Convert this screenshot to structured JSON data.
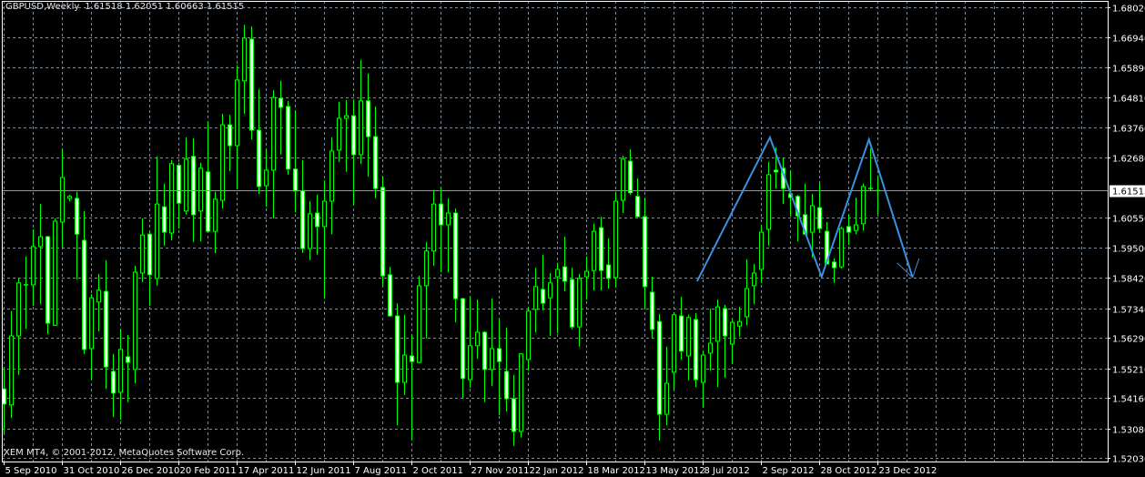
{
  "header": {
    "symbol_period": "GBPUSD,Weekly",
    "ohlc": "1.61518 1.62051 1.60663 1.61515"
  },
  "footer": {
    "copyright": "XEM MT4, © 2001-2012, MetaQuotes Software Corp."
  },
  "colors": {
    "background": "#000000",
    "grid": "#7f8b99",
    "candle_outline": "#00ff00",
    "bull_fill": "#000000",
    "bear_fill": "#ffffff",
    "axis_text": "#ffffff",
    "drawing": "#3d8fe0",
    "price_line": "#8a96a6"
  },
  "chart_data": {
    "type": "candlestick",
    "title": "GBPUSD,Weekly",
    "symbol": "GBPUSD",
    "period": "Weekly",
    "ylim": [
      1.5203,
      1.6802
    ],
    "grid": true,
    "y_tick_labels": [
      "1.68020",
      "1.66940",
      "1.65890",
      "1.64810",
      "1.63760",
      "1.62680",
      "1.60550",
      "1.59500",
      "1.58420",
      "1.57340",
      "1.56290",
      "1.55210",
      "1.54160",
      "1.53080",
      "1.52030"
    ],
    "current_price": "1.61515",
    "x_tick_labels": [
      "5 Sep 2010",
      "31 Oct 2010",
      "26 Dec 2010",
      "20 Feb 2011",
      "17 Apr 2011",
      "12 Jun 2011",
      "7 Aug 2011",
      "2 Oct 2011",
      "27 Nov 2011",
      "22 Jan 2012",
      "18 Mar 2012",
      "13 May 2012",
      "8 Jul 2012",
      "2 Sep 2012",
      "28 Oct 2012",
      "23 Dec 2012"
    ],
    "x_tick_every_bars": 8,
    "ohlc": [
      [
        1.5448,
        1.5526,
        1.5294,
        1.5394
      ],
      [
        1.5391,
        1.5724,
        1.5345,
        1.5636
      ],
      [
        1.5636,
        1.584,
        1.5498,
        1.5824
      ],
      [
        1.5817,
        1.5918,
        1.5662,
        1.5817
      ],
      [
        1.5817,
        1.6014,
        1.5743,
        1.5953
      ],
      [
        1.5953,
        1.6104,
        1.5749,
        1.5988
      ],
      [
        1.5988,
        1.5991,
        1.5642,
        1.5681
      ],
      [
        1.5674,
        1.6053,
        1.5671,
        1.6043
      ],
      [
        1.604,
        1.6298,
        1.5953,
        1.6198
      ],
      [
        1.6124,
        1.6137,
        1.6114,
        1.6131
      ],
      [
        1.6124,
        1.6147,
        1.5836,
        1.5997
      ],
      [
        1.5975,
        1.6079,
        1.5572,
        1.5588
      ],
      [
        1.5591,
        1.5784,
        1.5478,
        1.5771
      ],
      [
        1.5756,
        1.5856,
        1.5652,
        1.5798
      ],
      [
        1.5794,
        1.5905,
        1.5448,
        1.5526
      ],
      [
        1.551,
        1.5572,
        1.5348,
        1.5433
      ],
      [
        1.5436,
        1.5659,
        1.5339,
        1.5588
      ],
      [
        1.5562,
        1.5639,
        1.5401,
        1.5542
      ],
      [
        1.5517,
        1.5885,
        1.5468,
        1.5862
      ],
      [
        1.5859,
        1.6053,
        1.5827,
        1.5994
      ],
      [
        1.5997,
        1.601,
        1.5743,
        1.5853
      ],
      [
        1.584,
        1.6273,
        1.5814,
        1.6104
      ],
      [
        1.6094,
        1.6176,
        1.5956,
        1.6004
      ],
      [
        1.6001,
        1.626,
        1.5975,
        1.6247
      ],
      [
        1.6241,
        1.625,
        1.6017,
        1.6107
      ],
      [
        1.6079,
        1.634,
        1.6066,
        1.6263
      ],
      [
        1.6273,
        1.6337,
        1.5969,
        1.6066
      ],
      [
        1.6079,
        1.625,
        1.5972,
        1.6231
      ],
      [
        1.6218,
        1.6395,
        1.6007,
        1.6007
      ],
      [
        1.6007,
        1.6147,
        1.593,
        1.6121
      ],
      [
        1.6117,
        1.6424,
        1.6088,
        1.6385
      ],
      [
        1.6385,
        1.6421,
        1.6221,
        1.6311
      ],
      [
        1.6311,
        1.6596,
        1.6156,
        1.6544
      ],
      [
        1.6541,
        1.674,
        1.6424,
        1.6693
      ],
      [
        1.6689,
        1.6734,
        1.6333,
        1.6366
      ],
      [
        1.6366,
        1.6511,
        1.614,
        1.6166
      ],
      [
        1.6169,
        1.6301,
        1.6094,
        1.6224
      ],
      [
        1.6224,
        1.6508,
        1.6053,
        1.6482
      ],
      [
        1.6479,
        1.6541,
        1.6279,
        1.6447
      ],
      [
        1.645,
        1.647,
        1.6208,
        1.6228
      ],
      [
        1.6228,
        1.6437,
        1.6075,
        1.615
      ],
      [
        1.615,
        1.626,
        1.593,
        1.5946
      ],
      [
        1.5946,
        1.6114,
        1.5905,
        1.6069
      ],
      [
        1.6072,
        1.6137,
        1.5924,
        1.6024
      ],
      [
        1.6024,
        1.6188,
        1.5768,
        1.6114
      ],
      [
        1.6114,
        1.634,
        1.5997,
        1.6292
      ],
      [
        1.6295,
        1.6467,
        1.6253,
        1.6408
      ],
      [
        1.6408,
        1.6473,
        1.6218,
        1.6417
      ],
      [
        1.6417,
        1.6473,
        1.6101,
        1.6279
      ],
      [
        1.6279,
        1.6615,
        1.6247,
        1.647
      ],
      [
        1.647,
        1.6567,
        1.6201,
        1.6343
      ],
      [
        1.6343,
        1.645,
        1.6124,
        1.6159
      ],
      [
        1.6163,
        1.6201,
        1.5817,
        1.5849
      ],
      [
        1.5853,
        1.5881,
        1.5704,
        1.5707
      ],
      [
        1.5707,
        1.5752,
        1.5319,
        1.5471
      ],
      [
        1.5471,
        1.5711,
        1.5426,
        1.5568
      ],
      [
        1.5565,
        1.5642,
        1.5265,
        1.5545
      ],
      [
        1.5542,
        1.5849,
        1.5539,
        1.5814
      ],
      [
        1.5814,
        1.5969,
        1.5627,
        1.5937
      ],
      [
        1.5937,
        1.615,
        1.5885,
        1.6104
      ],
      [
        1.6104,
        1.6163,
        1.5862,
        1.603
      ],
      [
        1.603,
        1.6124,
        1.5862,
        1.6072
      ],
      [
        1.6072,
        1.6088,
        1.5684,
        1.5768
      ],
      [
        1.5768,
        1.5771,
        1.5416,
        1.5485
      ],
      [
        1.5481,
        1.5775,
        1.5452,
        1.5601
      ],
      [
        1.5601,
        1.5765,
        1.5555,
        1.5649
      ],
      [
        1.5649,
        1.5652,
        1.5401,
        1.5517
      ],
      [
        1.5517,
        1.5768,
        1.5458,
        1.5591
      ],
      [
        1.5591,
        1.5697,
        1.5355,
        1.5545
      ],
      [
        1.551,
        1.5665,
        1.5368,
        1.5413
      ],
      [
        1.5413,
        1.5498,
        1.5245,
        1.5297
      ],
      [
        1.5297,
        1.5575,
        1.5275,
        1.5572
      ],
      [
        1.5552,
        1.5736,
        1.5513,
        1.5724
      ],
      [
        1.573,
        1.5878,
        1.5649,
        1.5811
      ],
      [
        1.5801,
        1.5924,
        1.5727,
        1.5752
      ],
      [
        1.5771,
        1.5859,
        1.5636,
        1.5824
      ],
      [
        1.5846,
        1.5895,
        1.5646,
        1.5872
      ],
      [
        1.5881,
        1.5988,
        1.5794,
        1.583
      ],
      [
        1.5836,
        1.5878,
        1.5659,
        1.5668
      ],
      [
        1.5668,
        1.5856,
        1.5598,
        1.584
      ],
      [
        1.5846,
        1.5918,
        1.5765,
        1.5865
      ],
      [
        1.5868,
        1.6034,
        1.5798,
        1.6007
      ],
      [
        1.602,
        1.6059,
        1.5798,
        1.5868
      ],
      [
        1.5888,
        1.5982,
        1.5804,
        1.584
      ],
      [
        1.5843,
        1.6147,
        1.5808,
        1.6114
      ],
      [
        1.6117,
        1.6276,
        1.6072,
        1.6263
      ],
      [
        1.6256,
        1.6298,
        1.6137,
        1.6144
      ],
      [
        1.6131,
        1.6195,
        1.6059,
        1.6059
      ],
      [
        1.6059,
        1.6124,
        1.573,
        1.5811
      ],
      [
        1.5791,
        1.5846,
        1.5627,
        1.5659
      ],
      [
        1.5687,
        1.5714,
        1.5265,
        1.5358
      ],
      [
        1.5358,
        1.5598,
        1.5319,
        1.5468
      ],
      [
        1.5507,
        1.572,
        1.5448,
        1.5711
      ],
      [
        1.5707,
        1.5775,
        1.5552,
        1.5582
      ],
      [
        1.5565,
        1.5711,
        1.5478,
        1.5701
      ],
      [
        1.5694,
        1.5717,
        1.5455,
        1.5481
      ],
      [
        1.5471,
        1.5582,
        1.5381,
        1.5568
      ],
      [
        1.5575,
        1.5733,
        1.5513,
        1.561
      ],
      [
        1.5617,
        1.5765,
        1.5455,
        1.5739
      ],
      [
        1.5733,
        1.5746,
        1.5488,
        1.5636
      ],
      [
        1.5607,
        1.5697,
        1.5536,
        1.5684
      ],
      [
        1.5671,
        1.5739,
        1.5633,
        1.5687
      ],
      [
        1.5704,
        1.5908,
        1.5674,
        1.5804
      ],
      [
        1.5814,
        1.5891,
        1.5749,
        1.5859
      ],
      [
        1.5872,
        1.603,
        1.5824,
        1.6004
      ],
      [
        1.6014,
        1.6253,
        1.5956,
        1.6208
      ],
      [
        1.6224,
        1.6305,
        1.6159,
        1.6218
      ],
      [
        1.6231,
        1.6269,
        1.6104,
        1.6159
      ],
      [
        1.614,
        1.6221,
        1.6059,
        1.6127
      ],
      [
        1.6131,
        1.6137,
        1.5972,
        1.6062
      ],
      [
        1.6066,
        1.6176,
        1.5994,
        1.5997
      ],
      [
        1.6004,
        1.614,
        1.5914,
        1.6098
      ],
      [
        1.6091,
        1.6176,
        1.6001,
        1.6017
      ],
      [
        1.6007,
        1.604,
        1.5891,
        1.5891
      ],
      [
        1.5898,
        1.5911,
        1.5824,
        1.5878
      ],
      [
        1.5881,
        1.6024,
        1.5875,
        1.6017
      ],
      [
        1.6024,
        1.6066,
        1.5959,
        1.6004
      ],
      [
        1.601,
        1.6127,
        1.5997,
        1.603
      ],
      [
        1.6034,
        1.6176,
        1.601,
        1.6166
      ],
      [
        1.6159,
        1.6301,
        1.615,
        1.6159
      ],
      [
        1.61518,
        1.62051,
        1.60663,
        1.61515
      ]
    ],
    "drawing_zigzag": {
      "points": [
        [
          95.3,
          1.583
        ],
        [
          105.3,
          1.634
        ],
        [
          112.4,
          1.5846
        ],
        [
          118.9,
          1.6333
        ],
        [
          124.9,
          1.5843
        ]
      ],
      "arrow_at_end": true
    }
  }
}
